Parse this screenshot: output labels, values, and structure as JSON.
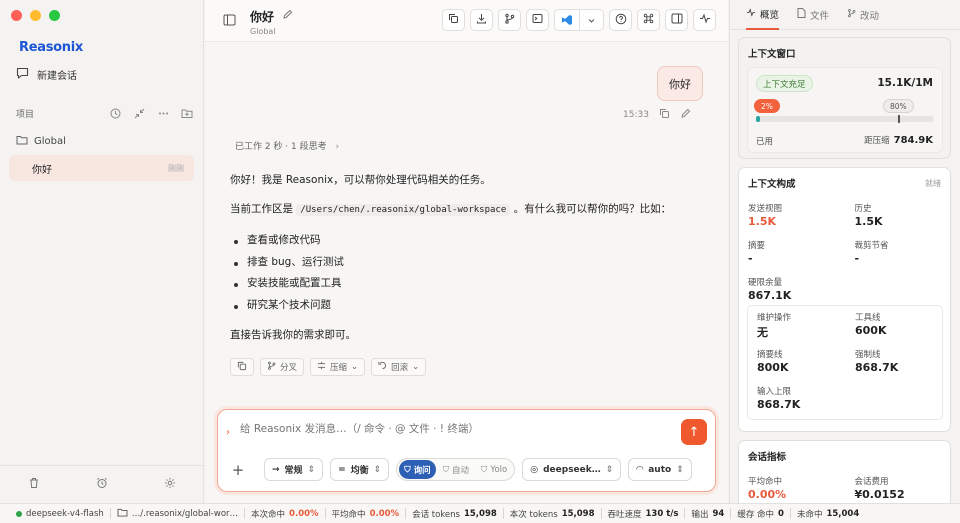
{
  "app": {
    "name": "Reasonix",
    "accent": "#e85a3c",
    "brand_color": "#1c55d6"
  },
  "sidebar": {
    "new_chat": "新建会话",
    "projects_label": "项目",
    "folder": "Global",
    "chat_title": "你好",
    "chat_time": "刚刚"
  },
  "header": {
    "title": "你好",
    "subtitle": "Global"
  },
  "conversation": {
    "user_message": "你好",
    "user_time": "15:33",
    "thinking": "已工作 2 秒 · 1 段思考",
    "reply_intro": "你好！我是 Reasonix，可以帮你处理代码相关的任务。",
    "reply_ws_prefix": "当前工作区是",
    "reply_ws_path": "/Users/chen/.reasonix/global-workspace",
    "reply_ws_suffix": "。有什么我可以帮你的吗？比如：",
    "reply_items": [
      "查看或修改代码",
      "排查 bug、运行测试",
      "安装技能或配置工具",
      "研究某个技术问题"
    ],
    "reply_outro": "直接告诉我你的需求即可。",
    "actions": {
      "branch": "分叉",
      "compress": "压缩",
      "rewind": "回滚"
    }
  },
  "composer": {
    "placeholder": "给 Reasonix 发消息…（/ 命令 · @ 文件 · ! 终端）",
    "mode_select": "常规",
    "balance_select": "均衡",
    "modes": {
      "ask": "询问",
      "auto": "自动",
      "yolo": "Yolo"
    },
    "model_select": "deepseek…",
    "effort_select": "auto"
  },
  "right_panel": {
    "tabs": {
      "overview": "概览",
      "files": "文件",
      "changes": "改动"
    },
    "context_window": {
      "title": "上下文窗口",
      "status": "上下文充足",
      "usage": "15.1K/1M",
      "percent_label": "2%",
      "percent_value": 0.02,
      "threshold_label": "80%",
      "used_label": "已用",
      "distance_label": "距压缩",
      "distance_value": "784.9K"
    },
    "composition": {
      "title": "上下文构成",
      "status": "就绪",
      "sent_view_label": "发送视图",
      "sent_view_value": "1.5K",
      "history_label": "历史",
      "history_value": "1.5K",
      "summary_label": "摘要",
      "summary_value": "-",
      "trim_label": "裁剪节省",
      "trim_value": "-",
      "hard_remaining_label": "硬限余量",
      "hard_remaining_value": "867.1K",
      "maintenance_label": "维护操作",
      "maintenance_value": "无",
      "tool_line_label": "工具线",
      "tool_line_value": "600K",
      "summary_line_label": "摘要线",
      "summary_line_value": "800K",
      "force_line_label": "强制线",
      "force_line_value": "868.7K",
      "input_limit_label": "输入上限",
      "input_limit_value": "868.7K"
    },
    "session_metrics": {
      "title": "会话指标",
      "avg_hit_label": "平均命中",
      "avg_hit_value": "0.00%",
      "cost_label": "会话费用",
      "cost_value": "¥0.0152"
    }
  },
  "statusbar": {
    "model": "deepseek-v4-flash",
    "path": "…/.reasonix/global-wor…",
    "hit_label": "本次命中",
    "hit_value": "0.00%",
    "avg_hit_label": "平均命中",
    "avg_hit_value": "0.00%",
    "session_tokens_label": "会话 tokens",
    "session_tokens_value": "15,098",
    "this_tokens_label": "本次 tokens",
    "this_tokens_value": "15,098",
    "throughput_label": "吞吐速度",
    "throughput_value": "130 t/s",
    "output_label": "输出",
    "output_value": "94",
    "cache_hit_label": "缓存 命中",
    "cache_hit_value": "0",
    "cache_miss_label": "未命中",
    "cache_miss_value": "15,004"
  }
}
